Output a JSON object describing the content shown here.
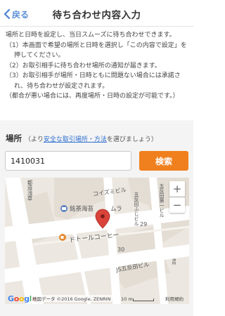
{
  "header": {
    "back_label": "戻る",
    "title": "待ち合わせ内容入力"
  },
  "intro": {
    "main": "場所と日時を設定し、当日スムーズに待ち合わせできます。",
    "step1": "（1）本画面で希望の場所と日時を選択し「この内容で設定」を押してください。",
    "step2": "（2）お取引相手に待ち合わせ場所の通知が届きます。",
    "step3": "（3）お取引相手が場所・日時ともに問題ない場合には承諾され、待ち合わせが設定されます。",
    "note": "（都合が悪い場合には、再度場所・日時の設定が可能です。）"
  },
  "place": {
    "label": "場所",
    "prefix": "（より",
    "link": "安全な取引場所・方法",
    "suffix": "を選びましょう）"
  },
  "search": {
    "value": "1410031",
    "button_label": "検索"
  },
  "map": {
    "labels": {
      "street_left": "都道浅草",
      "building_1": "コイズミビル",
      "building_2": "五反田第一ビル",
      "building_3": "五反田ふじビル",
      "building_4": "JS五反田ビル",
      "building_5": "RE",
      "shop_1": "銘茶海苔",
      "shop_1b": "ムラ",
      "cafe": "ドトールコーヒー",
      "num_29": "29",
      "num_30": "30"
    },
    "zoom_in": "+",
    "zoom_out": "−",
    "google": "Google",
    "copyright": "地図データ ©2016 Google, ZENRIN",
    "scale": "10 m",
    "terms": "利用規約",
    "marker_color": "#d9433a"
  },
  "colors": {
    "accent": "#f0801e",
    "link": "#2d6fd1",
    "back": "#5a8fd6"
  }
}
